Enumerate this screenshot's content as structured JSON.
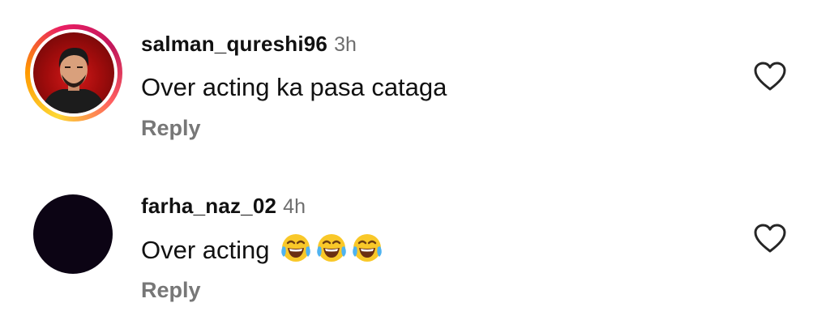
{
  "comments": [
    {
      "username": "salman_qureshi96",
      "timestamp": "3h",
      "text": "Over acting ka pasa cataga",
      "reply_label": "Reply",
      "has_story_ring": true
    },
    {
      "username": "farha_naz_02",
      "timestamp": "4h",
      "text": "Over acting",
      "emojis": [
        "😂",
        "😂",
        "😂"
      ],
      "reply_label": "Reply",
      "has_story_ring": false
    }
  ],
  "icons": {
    "like": "heart-outline-icon",
    "emoji": "face-with-tears-of-joy-icon"
  },
  "colors": {
    "text": "#111111",
    "timestamp": "#6e6e6e",
    "reply": "#777777",
    "story_ring": [
      "#fdd835",
      "#ff9800",
      "#e91e63"
    ]
  }
}
